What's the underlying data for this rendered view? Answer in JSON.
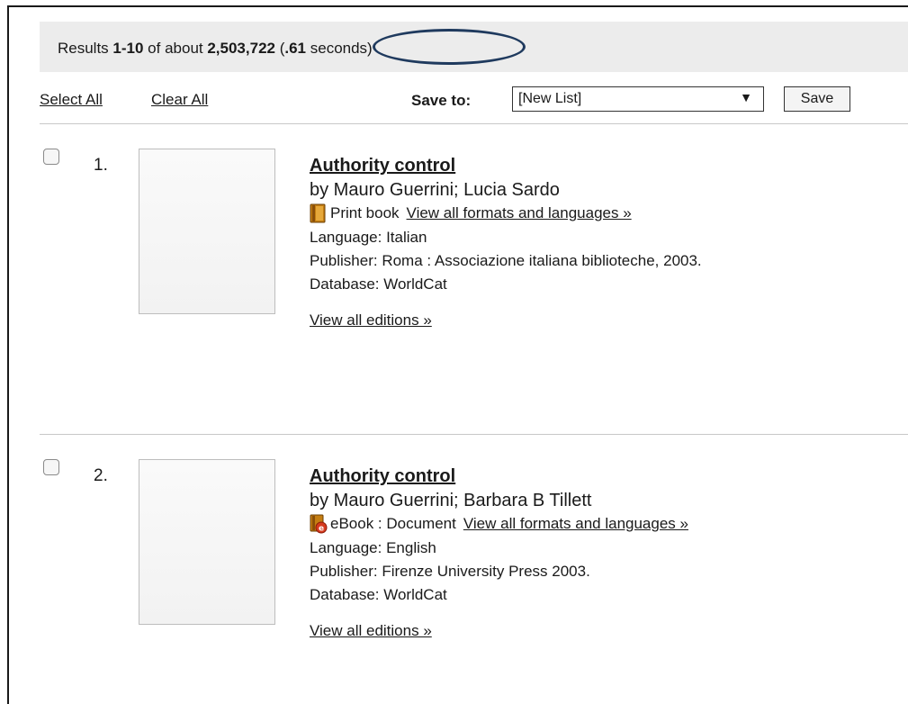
{
  "summary": {
    "prefix": "Results ",
    "range": "1-10",
    "mid": " of about ",
    "total": "2,503,722",
    "time_open": " (",
    "time": ".61",
    "time_close": " seconds)"
  },
  "toolbar": {
    "select_all": "Select All",
    "clear_all": "Clear All",
    "save_to_label": "Save to:",
    "list_value": "[New List]",
    "list_arrow": "▼",
    "save_button": "Save"
  },
  "results": [
    {
      "number": "1.",
      "title": "Authority control",
      "authors": "by Mauro Guerrini; Lucia Sardo",
      "format": "Print book",
      "format_icon": "print-book-icon",
      "view_formats": "View all formats and languages »",
      "language": "Language: Italian",
      "publisher": "Publisher: Roma : Associazione italiana biblioteche, 2003.",
      "database": "Database: WorldCat",
      "view_editions": "View all editions »"
    },
    {
      "number": "2.",
      "title": "Authority control",
      "authors": "by Mauro Guerrini; Barbara B Tillett",
      "format": "eBook : Document",
      "format_icon": "ebook-icon",
      "view_formats": "View all formats and languages »",
      "language": "Language: English",
      "publisher": "Publisher: Firenze University Press 2003.",
      "database": "Database: WorldCat",
      "view_editions": "View all editions »"
    }
  ],
  "colors": {
    "summary_bg": "#ececec",
    "circle_annotation": "#1f3a5e",
    "book_icon": "#b8730d"
  }
}
